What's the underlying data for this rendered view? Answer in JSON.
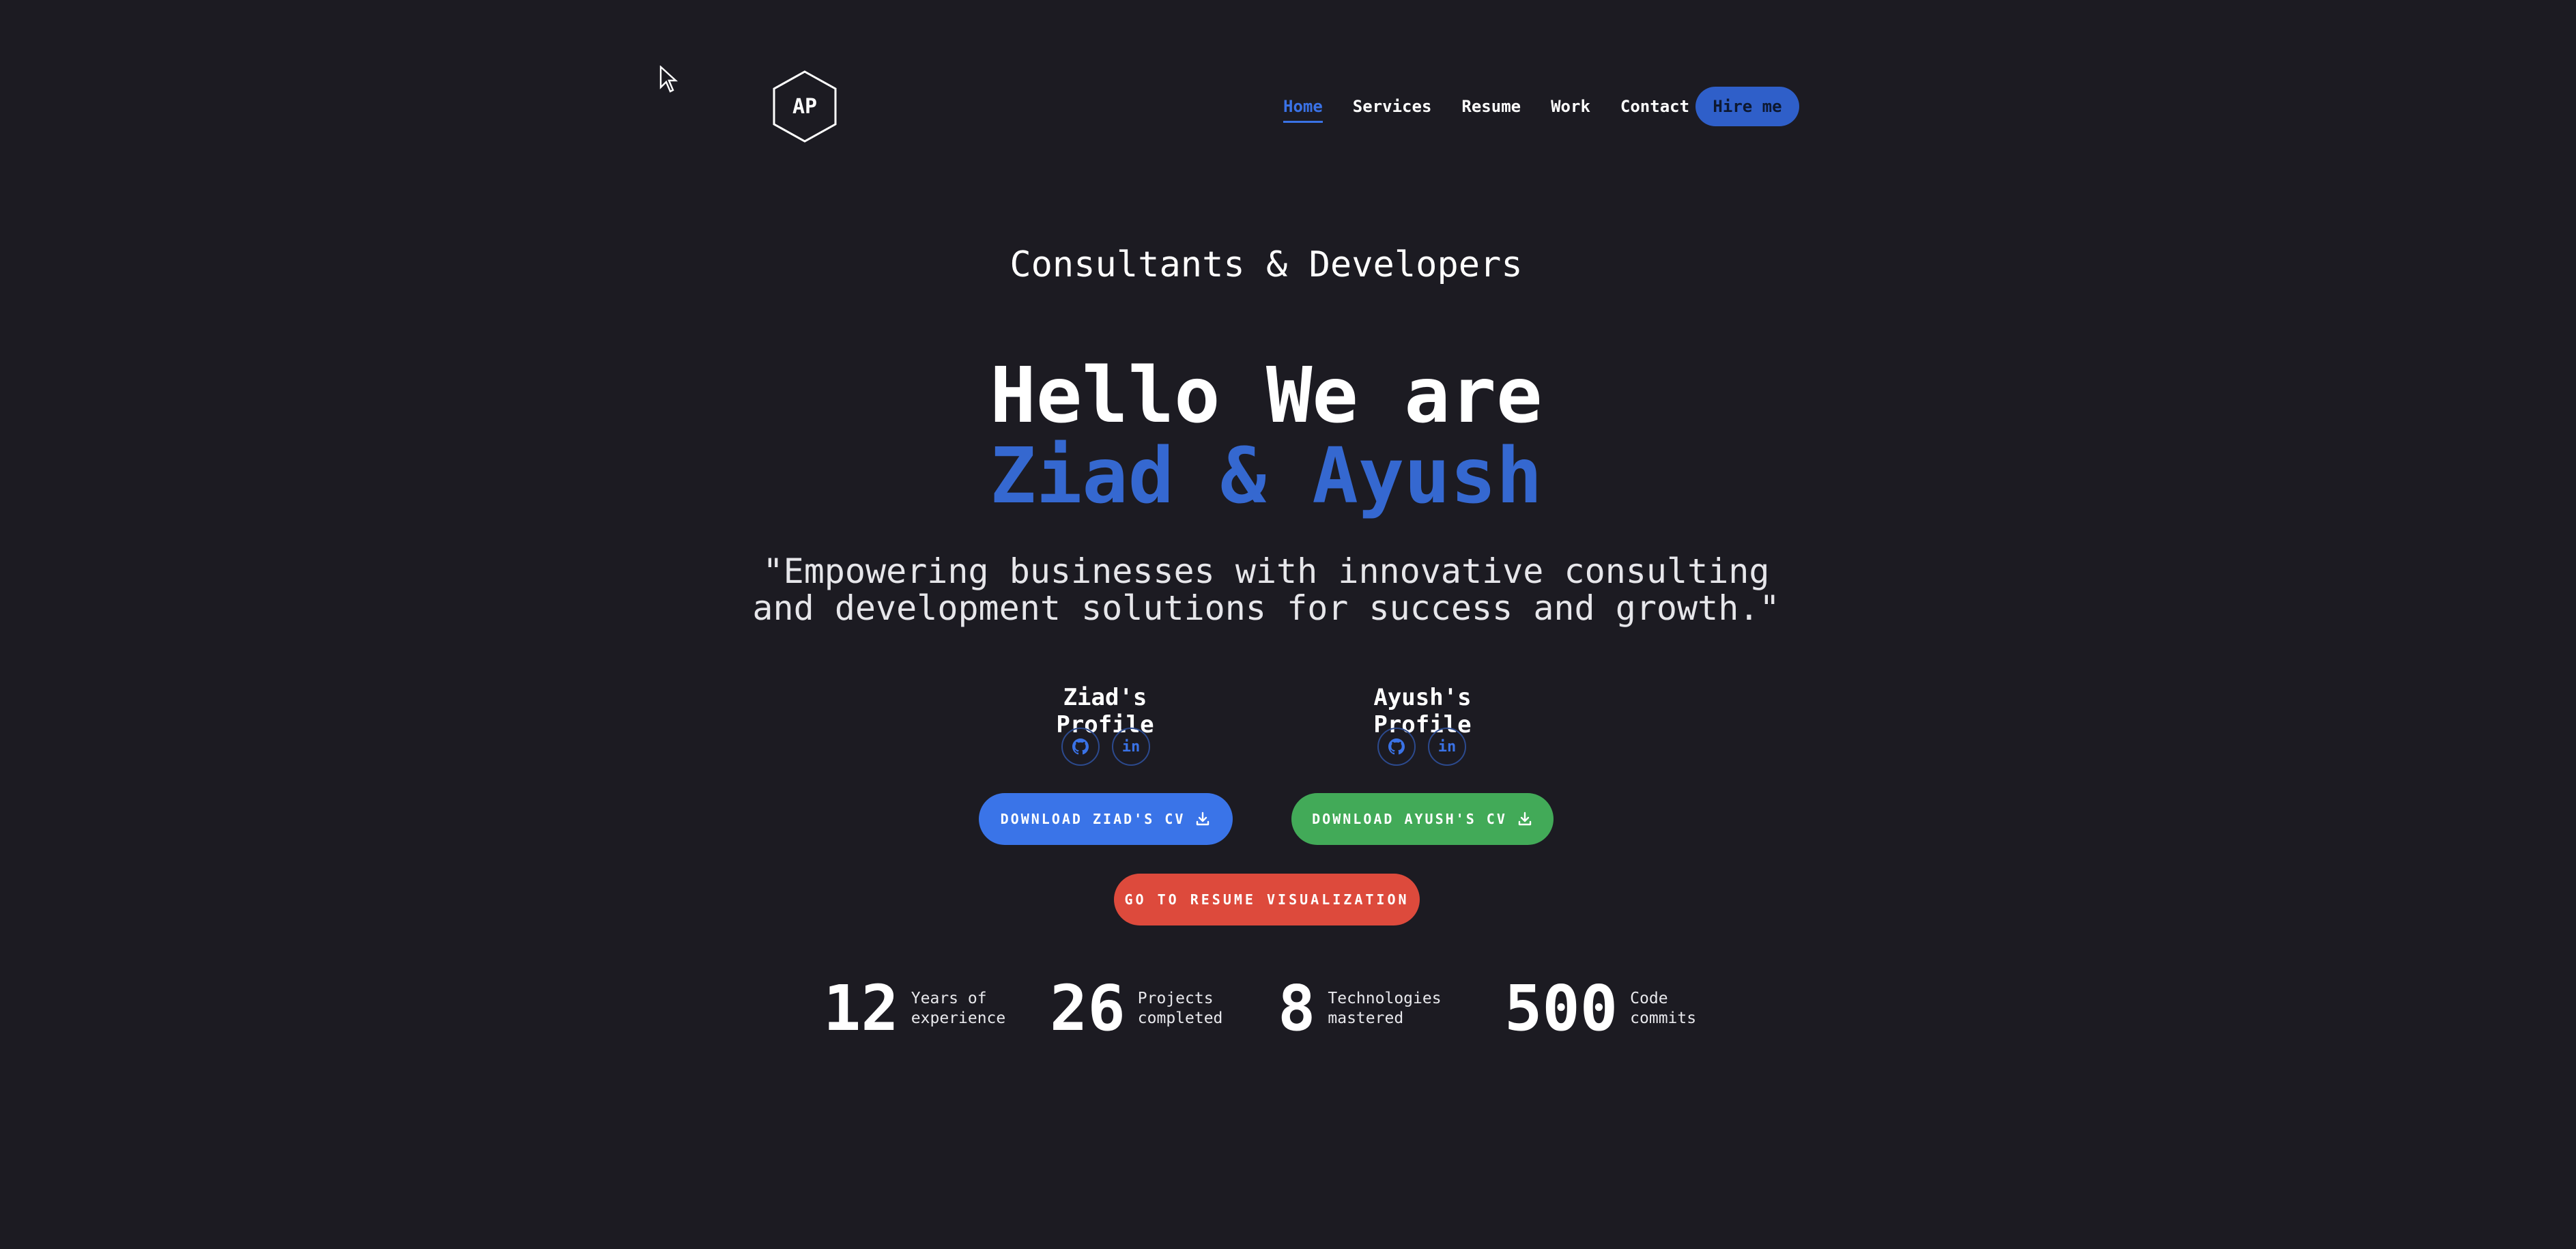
{
  "header": {
    "logo_text": "AP",
    "nav": [
      {
        "label": "Home",
        "active": true
      },
      {
        "label": "Services",
        "active": false
      },
      {
        "label": "Resume",
        "active": false
      },
      {
        "label": "Work",
        "active": false
      },
      {
        "label": "Contact",
        "active": false
      }
    ],
    "hire_label": "Hire me"
  },
  "hero": {
    "subtitle": "Consultants & Developers",
    "hello": "Hello We are",
    "names": "Ziad & Ayush",
    "quote_line1": "\"Empowering businesses with innovative consulting",
    "quote_line2": "and development solutions for success and growth.\""
  },
  "profiles": {
    "ziad_title": "Ziad's Profile",
    "ayush_title": "Ayush's Profile",
    "github_icon": "github-icon",
    "linkedin_icon": "linkedin-icon",
    "linkedin_glyph": "in"
  },
  "buttons": {
    "ziad_cv": "DOWNLOAD ZIAD'S CV",
    "ayush_cv": "DOWNLOAD AYUSH'S CV",
    "resume_viz": "GO TO RESUME VISUALIZATION"
  },
  "stats": [
    {
      "number": "12",
      "label_line1": "Years of",
      "label_line2": "experience"
    },
    {
      "number": "26",
      "label_line1": "Projects",
      "label_line2": "completed"
    },
    {
      "number": "8",
      "label_line1": "Technologies",
      "label_line2": "mastered"
    },
    {
      "number": "500",
      "label_line1": "Code",
      "label_line2": "commits"
    }
  ],
  "colors": {
    "background": "#1c1b22",
    "accent_blue": "#3568d0",
    "button_blue": "#3a74e8",
    "button_green": "#42aa58",
    "button_red": "#dd4a3c"
  }
}
